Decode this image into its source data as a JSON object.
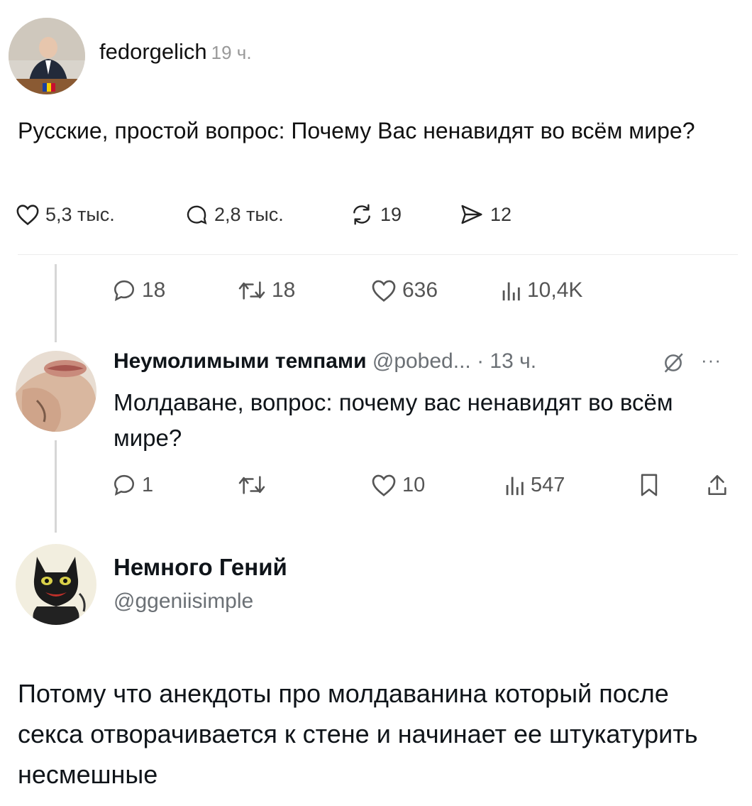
{
  "post": {
    "username": "fedorgelich",
    "time": "19 ч.",
    "text": "Русские, простой вопрос:  Почему Вас ненавидят во всём мире?",
    "likes": "5,3 тыс.",
    "comments": "2,8 тыс.",
    "reposts": "19",
    "shares": "12"
  },
  "tweet_metrics": {
    "replies": "18",
    "retweets": "18",
    "likes": "636",
    "views": "10,4K"
  },
  "reply": {
    "display_name": "Неумолимыми темпами",
    "handle": "@pobed...",
    "time": "· 13 ч.",
    "more": "···",
    "text": "Молдаване, вопрос: почему вас ненавидят во всём мире?",
    "replies": "1",
    "retweets": "",
    "likes": "10",
    "views": "547"
  },
  "answer": {
    "display_name": "Немного Гений",
    "handle": "@ggeniisimple",
    "text": "Потому что анекдоты про молдаванина который после секса отворачивается к стене и начинает ее штукатурить несмешные"
  },
  "icons": [
    "heart-icon",
    "comment-icon",
    "repost-icon",
    "send-icon",
    "reply-icon",
    "retweet-icon",
    "views-icon",
    "bookmark-icon",
    "share-icon",
    "grok-icon"
  ]
}
